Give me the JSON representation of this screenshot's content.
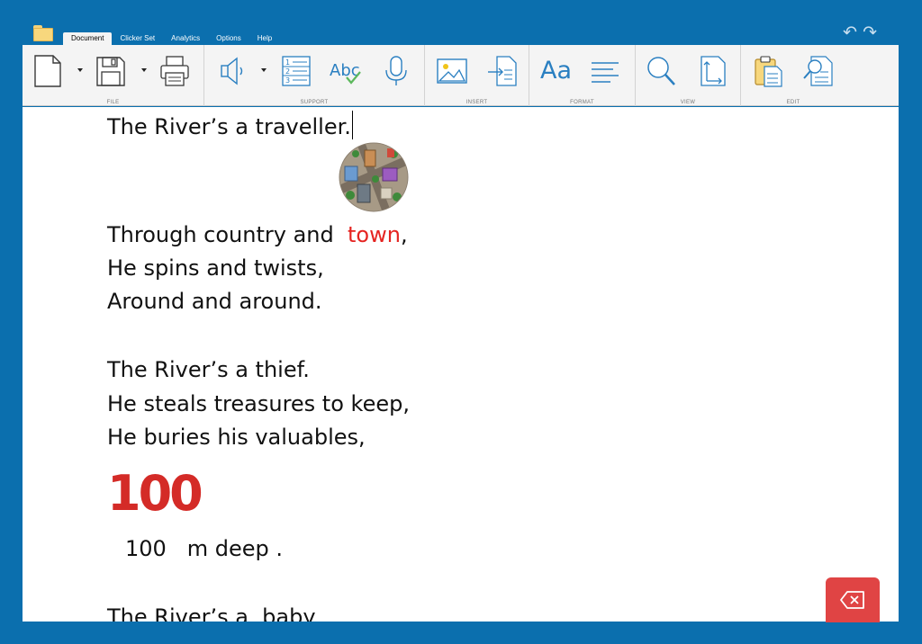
{
  "app": {
    "folder_icon": "folder-icon",
    "tabs": [
      {
        "label": "Document",
        "active": true
      },
      {
        "label": "Clicker Set",
        "active": false
      },
      {
        "label": "Analytics",
        "active": false
      },
      {
        "label": "Options",
        "active": false
      },
      {
        "label": "Help",
        "active": false
      }
    ],
    "undo_icon": "undo-icon",
    "redo_icon": "redo-icon"
  },
  "ribbon": {
    "groups": [
      {
        "label": "FILE",
        "icons": [
          "new-document-icon",
          "save-icon",
          "print-icon"
        ]
      },
      {
        "label": "SUPPORT",
        "icons": [
          "speaker-icon",
          "numbered-list-icon",
          "spellcheck-icon",
          "microphone-icon"
        ]
      },
      {
        "label": "INSERT",
        "icons": [
          "image-icon",
          "insert-file-icon"
        ]
      },
      {
        "label": "FORMAT",
        "icons": [
          "font-icon",
          "align-icon"
        ]
      },
      {
        "label": "VIEW",
        "icons": [
          "zoom-icon",
          "page-size-icon"
        ]
      },
      {
        "label": "EDIT",
        "icons": [
          "paste-icon",
          "find-icon"
        ]
      }
    ],
    "font_sample": "Aa",
    "spell_sample": "Abc"
  },
  "document": {
    "lines": {
      "l1": "The River’s a traveller.",
      "l2a": "Through country and  ",
      "l2b": "town",
      "l2c": ",",
      "l3": "He spins and twists,",
      "l4": "Around and around.",
      "l5": "The River’s a thief.",
      "l6": "He steals treasures to keep,",
      "l7": "He buries his valuables,",
      "bignum": "100",
      "l8": "100   m deep .",
      "l9": "The River’s a  baby"
    },
    "image": "town-map-image",
    "colors": {
      "highlight": "#e52421",
      "bignum": "#d42b27",
      "background": "#0b6fae"
    }
  },
  "delete_button": {
    "icon": "backspace-icon"
  }
}
